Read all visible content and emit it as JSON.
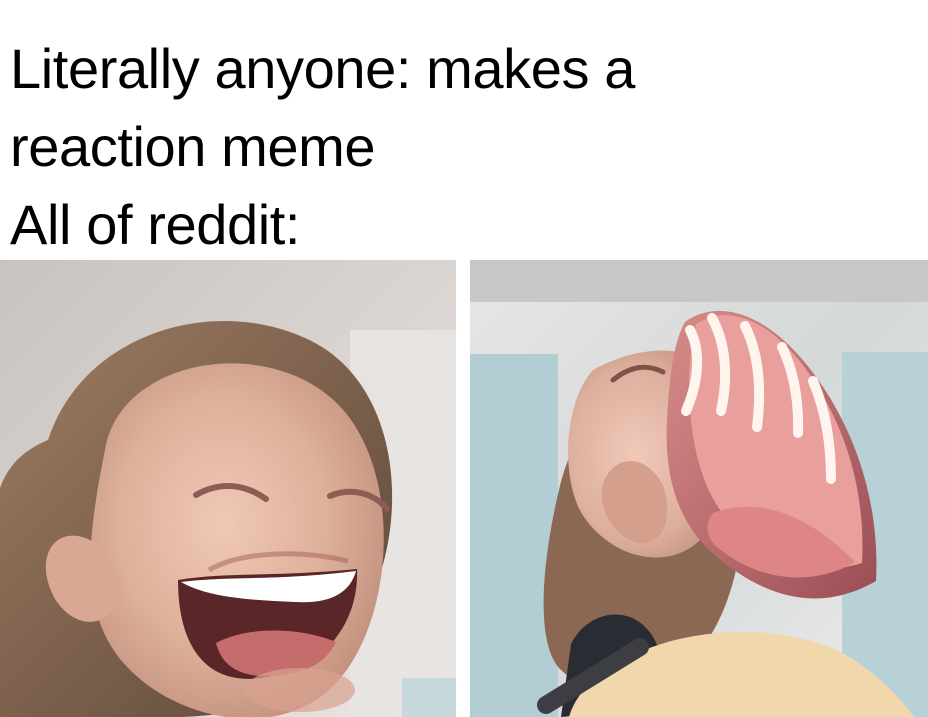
{
  "meme": {
    "caption_lines": [
      "Literally anyone: makes a",
      "reaction meme",
      "All of reddit:"
    ]
  },
  "panels": [
    {
      "name": "left-panel-normal-laugh"
    },
    {
      "name": "right-panel-exaggerated-laugh"
    }
  ],
  "colors": {
    "background": "#ffffff",
    "text": "#000000",
    "skin": "#e6b8a3",
    "hair": "#8a6a52",
    "mouth": "#c57a78",
    "wall": "#d7d9d9",
    "locker_blue": "#a9c7cf"
  }
}
